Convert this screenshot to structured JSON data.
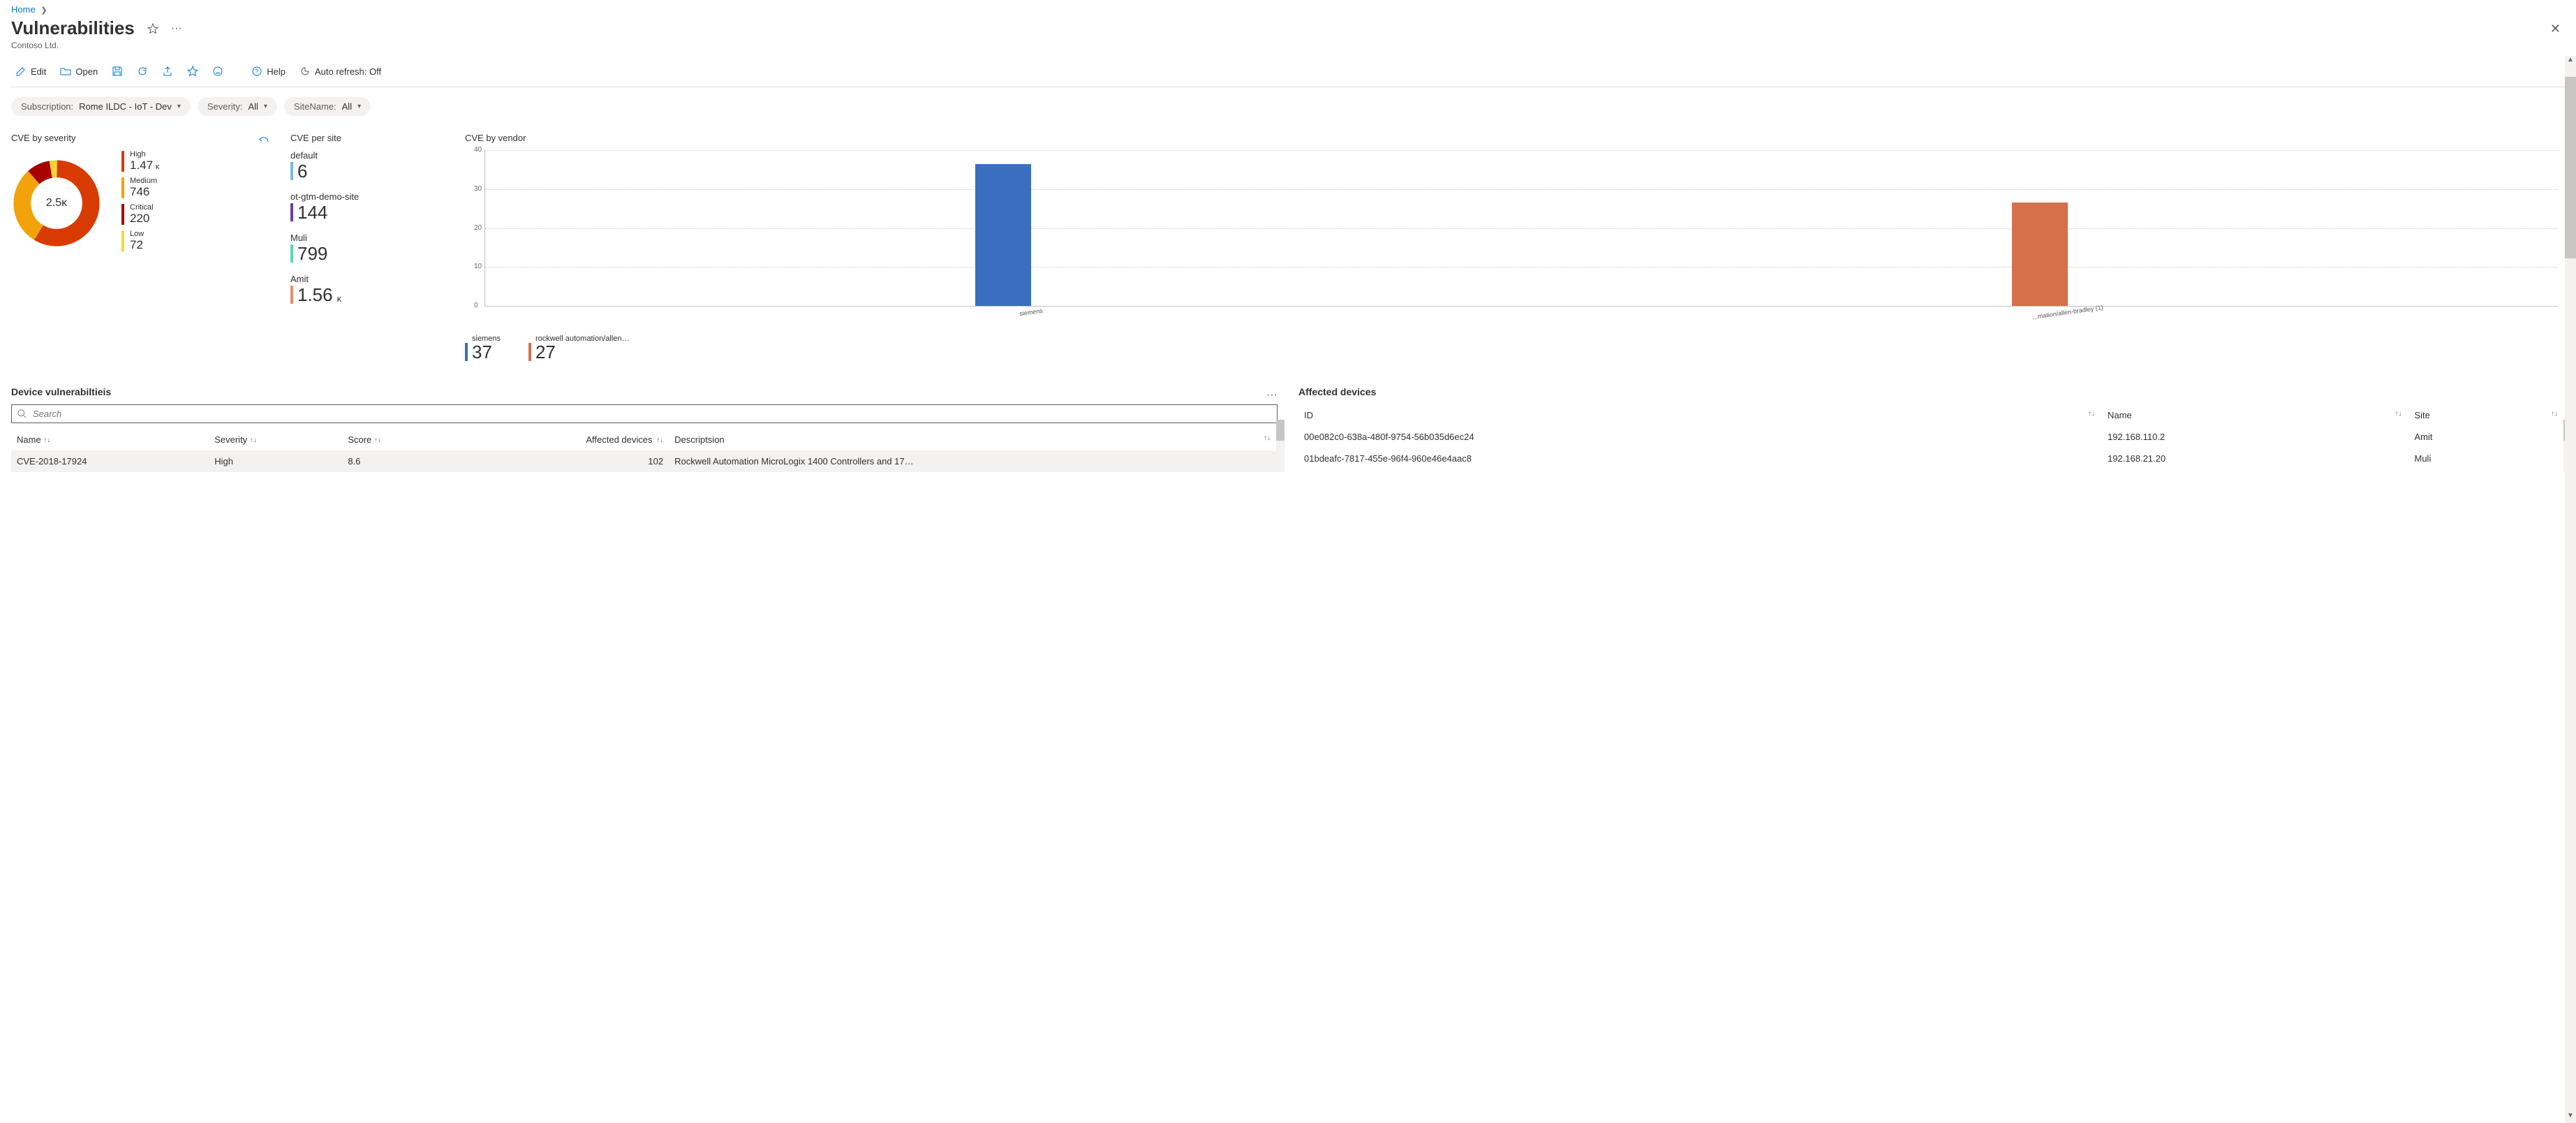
{
  "breadcrumb": {
    "home": "Home"
  },
  "page": {
    "title": "Vulnerabilities",
    "subtitle": "Contoso Ltd."
  },
  "commands": {
    "edit": "Edit",
    "open": "Open",
    "help": "Help",
    "autorefresh_label": "Auto refresh:",
    "autorefresh_value": "Off"
  },
  "filters": [
    {
      "label": "Subscription:",
      "value": "Rome ILDC - IoT - Dev"
    },
    {
      "label": "Severity:",
      "value": "All"
    },
    {
      "label": "SiteName:",
      "value": "All"
    }
  ],
  "severity": {
    "title": "CVE by severity",
    "total": "2.5ᴋ",
    "items": [
      {
        "label": "High",
        "value": "1.47",
        "suffix": "ᴋ",
        "color": "#d83b01"
      },
      {
        "label": "Medium",
        "value": "746",
        "suffix": "",
        "color": "#f2a30c"
      },
      {
        "label": "Critical",
        "value": "220",
        "suffix": "",
        "color": "#a80000"
      },
      {
        "label": "Low",
        "value": "72",
        "suffix": "",
        "color": "#ffd335"
      }
    ]
  },
  "persite": {
    "title": "CVE per site",
    "items": [
      {
        "label": "default",
        "value": "6",
        "suffix": "",
        "color": "#7ab8e6"
      },
      {
        "label": "ot-gtm-demo-site",
        "value": "144",
        "suffix": "",
        "color": "#6b3fa0"
      },
      {
        "label": "Muli",
        "value": "799",
        "suffix": "",
        "color": "#5ed6b0"
      },
      {
        "label": "Amit",
        "value": "1.56",
        "suffix": "ᴋ",
        "color": "#e58f65"
      }
    ]
  },
  "byvendor": {
    "title": "CVE by vendor",
    "ymax": 40,
    "ticks": [
      "40",
      "30",
      "20",
      "10",
      "0"
    ],
    "bars": [
      {
        "label_short": "siemens",
        "label_full": "siemens",
        "value": 37,
        "color": "#3a6fbf"
      },
      {
        "label_short": "...mation/allen-bradley (1)",
        "label_full": "rockwell automation/allen-bradley (1)",
        "value": 27,
        "color": "#d6704a"
      }
    ],
    "legend": [
      {
        "label": "siemens",
        "value": "37",
        "color": "#3a6fbf"
      },
      {
        "label": "rockwell automation/allen…",
        "value": "27",
        "color": "#d6704a"
      }
    ]
  },
  "dev_vuln": {
    "title": "Device vulnerabiltieis",
    "search_placeholder": "Search",
    "columns": [
      "Name",
      "Severity",
      "Score",
      "Affected devices",
      "Descriptsion"
    ],
    "rows": [
      {
        "name": "CVE-2018-17924",
        "severity": "High",
        "score": "8.6",
        "affected": "102",
        "desc": "Rockwell Automation MicroLogix 1400 Controllers and 17…"
      }
    ]
  },
  "affected": {
    "title": "Affected devices",
    "columns": [
      "ID",
      "Name",
      "Site"
    ],
    "rows": [
      {
        "id": "00e082c0-638a-480f-9754-56b035d6ec24",
        "name": "192.168.110.2",
        "site": "Amit"
      },
      {
        "id": "01bdeafc-7817-455e-96f4-960e46e4aac8",
        "name": "192.168.21.20",
        "site": "Muli"
      }
    ]
  },
  "chart_data": [
    {
      "type": "pie",
      "title": "CVE by severity",
      "categories": [
        "High",
        "Medium",
        "Critical",
        "Low"
      ],
      "values": [
        1470,
        746,
        220,
        72
      ],
      "total_label": "2.5K"
    },
    {
      "type": "bar",
      "title": "CVE by vendor",
      "categories": [
        "siemens",
        "rockwell automation/allen-bradley (1)"
      ],
      "values": [
        37,
        27
      ],
      "ylim": [
        0,
        40
      ],
      "xlabel": "",
      "ylabel": ""
    },
    {
      "type": "table",
      "title": "CVE per site",
      "categories": [
        "default",
        "ot-gtm-demo-site",
        "Muli",
        "Amit"
      ],
      "values": [
        6,
        144,
        799,
        1560
      ]
    }
  ]
}
